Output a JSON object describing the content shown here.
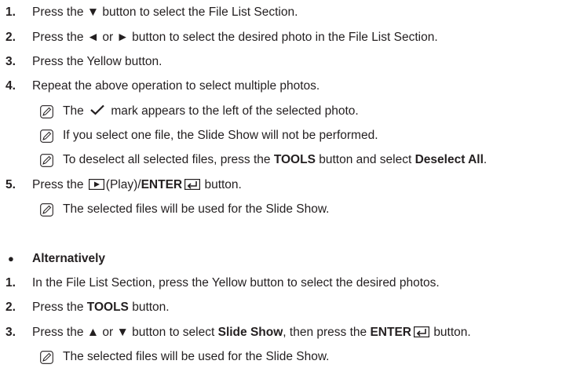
{
  "steps": {
    "s1": {
      "num": "1.",
      "a": "Press the ▼ button to select the File List Section."
    },
    "s2": {
      "num": "2.",
      "a": "Press the ◄ or ► button to select the desired photo in the File List Section."
    },
    "s3": {
      "num": "3.",
      "a": "Press the Yellow button."
    },
    "s4": {
      "num": "4.",
      "a": "Repeat the above operation to select multiple photos."
    },
    "n1": {
      "a": "The",
      "b": "mark appears to the left of the selected photo."
    },
    "n2": {
      "a": "If you select one file, the Slide Show will not be performed."
    },
    "n3": {
      "a": "To deselect all selected files, press the ",
      "b": "TOOLS",
      "c": " button and select ",
      "d": "Deselect All",
      "e": "."
    },
    "s5": {
      "num": "5.",
      "a": "Press the",
      "b": "(Play)/",
      "c": "ENTER",
      "d": "button."
    },
    "n4": {
      "a": "The selected files will be used for the Slide Show."
    }
  },
  "alternative": {
    "bullet": "●",
    "heading": "Alternatively",
    "s1": {
      "num": "1.",
      "a": "In the File List Section, press the Yellow button to select the desired photos."
    },
    "s2": {
      "num": "2.",
      "a": "Press the ",
      "b": "TOOLS",
      "c": " button."
    },
    "s3": {
      "num": "3.",
      "a": "Press the ▲ or ▼ button to select ",
      "b": "Slide Show",
      "c": ", then press the ",
      "d": "ENTER",
      "e": "button."
    },
    "n1": {
      "a": "The selected files will be used for the Slide Show."
    }
  },
  "icons": {
    "note": "note-icon",
    "check": "checkmark-icon",
    "play": "play-button-icon",
    "enter": "enter-button-icon"
  }
}
